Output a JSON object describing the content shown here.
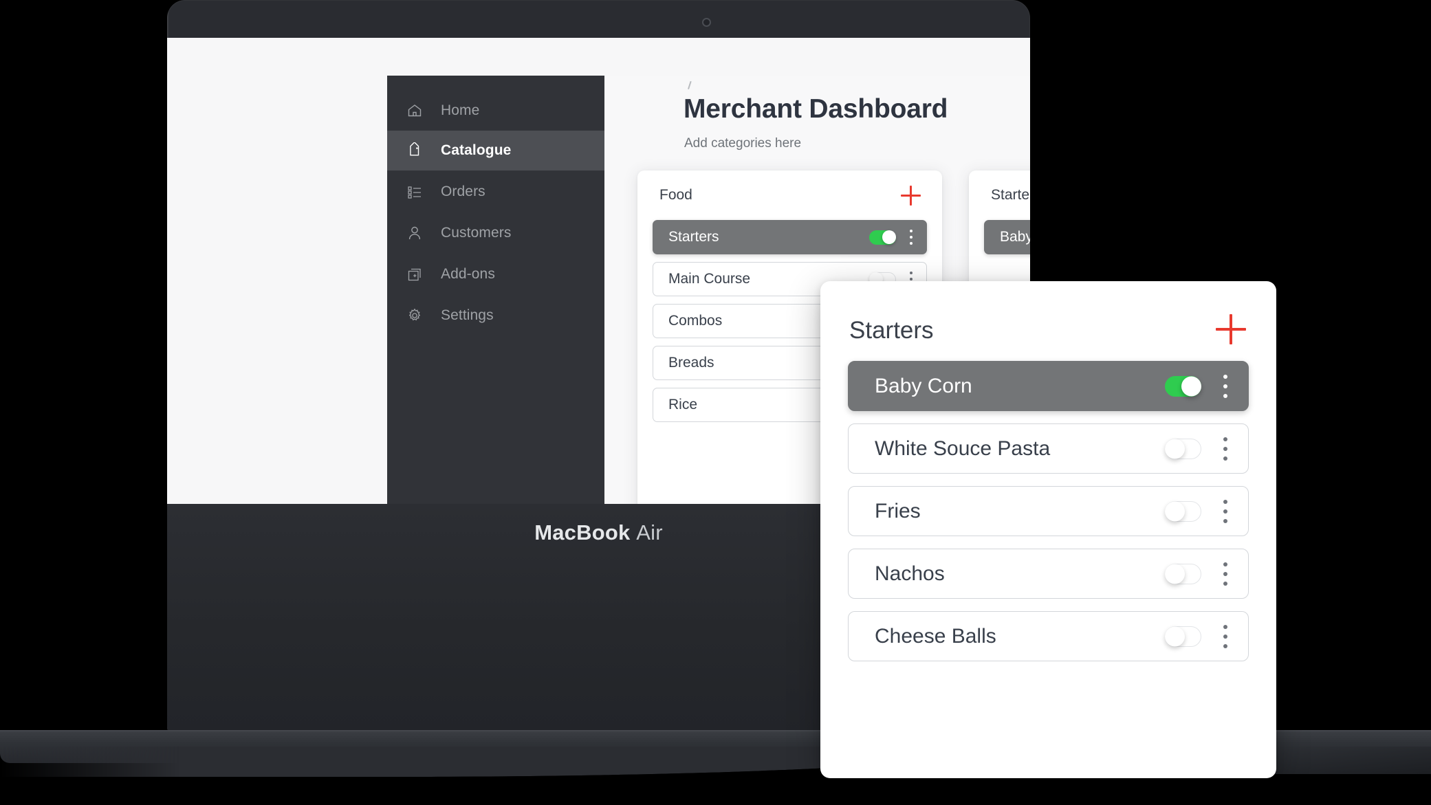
{
  "device": {
    "brand_bold": "MacBook",
    "brand_light": "Air",
    "camera_icon": "camera-dot-icon"
  },
  "sidebar": {
    "items": [
      {
        "label": "Home",
        "icon": "home-icon",
        "active": false
      },
      {
        "label": "Catalogue",
        "icon": "tag-icon",
        "active": true
      },
      {
        "label": "Orders",
        "icon": "list-icon",
        "active": false
      },
      {
        "label": "Customers",
        "icon": "person-icon",
        "active": false
      },
      {
        "label": "Add-ons",
        "icon": "add-square-icon",
        "active": false
      },
      {
        "label": "Settings",
        "icon": "gear-icon",
        "active": false
      }
    ]
  },
  "header": {
    "title": "Merchant Dashboard",
    "subtitle": "Add categories here"
  },
  "colors": {
    "accent_red": "#e8392e",
    "toggle_on_green": "#2fcc4f",
    "selected_row_gray": "#737577",
    "sidebar_bg": "#313338",
    "sidebar_active_bg": "#4d4f54",
    "page_bg": "#f8f8f9"
  },
  "cards": [
    {
      "title": "Food",
      "add_icon": "plus-icon",
      "rows": [
        {
          "label": "Starters",
          "toggle": "on",
          "selected": true,
          "menu_icon": "kebab-menu-icon"
        },
        {
          "label": "Main Course",
          "toggle": "off",
          "selected": false,
          "menu_icon": "kebab-menu-icon"
        },
        {
          "label": "Combos",
          "toggle": "off",
          "selected": false,
          "menu_icon": "kebab-menu-icon"
        },
        {
          "label": "Breads",
          "toggle": "off",
          "selected": false,
          "menu_icon": "kebab-menu-icon"
        },
        {
          "label": "Rice",
          "toggle": "off",
          "selected": false,
          "menu_icon": "kebab-menu-icon"
        }
      ]
    },
    {
      "title": "Starters",
      "add_icon": "plus-icon",
      "rows": [
        {
          "label": "Baby Corn",
          "toggle": "on",
          "selected": true,
          "menu_icon": "kebab-menu-icon"
        }
      ]
    }
  ],
  "modal": {
    "title": "Starters",
    "add_icon": "plus-icon",
    "rows": [
      {
        "label": "Baby Corn",
        "toggle": "on",
        "selected": true,
        "menu_icon": "kebab-menu-icon"
      },
      {
        "label": "White Souce Pasta",
        "toggle": "off",
        "selected": false,
        "menu_icon": "kebab-menu-icon"
      },
      {
        "label": "Fries",
        "toggle": "off",
        "selected": false,
        "menu_icon": "kebab-menu-icon"
      },
      {
        "label": "Nachos",
        "toggle": "off",
        "selected": false,
        "menu_icon": "kebab-menu-icon"
      },
      {
        "label": "Cheese Balls",
        "toggle": "off",
        "selected": false,
        "menu_icon": "kebab-menu-icon"
      }
    ]
  }
}
